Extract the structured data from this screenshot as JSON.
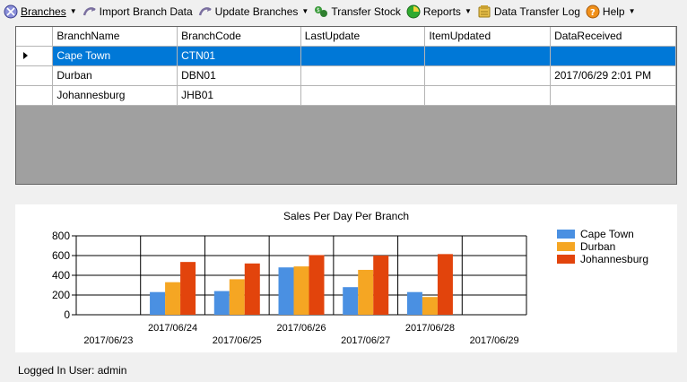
{
  "toolbar": {
    "items": [
      {
        "label": "Branches",
        "icon": "branches-icon",
        "dropdown": true
      },
      {
        "label": "Import Branch Data",
        "icon": "import-icon",
        "dropdown": false
      },
      {
        "label": "Update Branches",
        "icon": "update-icon",
        "dropdown": true
      },
      {
        "label": "Transfer Stock",
        "icon": "transfer-icon",
        "dropdown": false
      },
      {
        "label": "Reports",
        "icon": "reports-icon",
        "dropdown": true
      },
      {
        "label": "Data Transfer Log",
        "icon": "log-icon",
        "dropdown": false
      },
      {
        "label": "Help",
        "icon": "help-icon",
        "dropdown": true
      }
    ]
  },
  "grid": {
    "columns": [
      "BranchName",
      "BranchCode",
      "LastUpdate",
      "ItemUpdated",
      "DataReceived"
    ],
    "rows": [
      [
        "Cape Town",
        "CTN01",
        "",
        "",
        ""
      ],
      [
        "Durban",
        "DBN01",
        "",
        "",
        "2017/06/29 2:01 PM"
      ],
      [
        "Johannesburg",
        "JHB01",
        "",
        "",
        ""
      ]
    ],
    "selected_row": 0
  },
  "chart_data": {
    "type": "bar",
    "title": "Sales Per Day Per Branch",
    "categories": [
      "2017/06/23",
      "2017/06/24",
      "2017/06/25",
      "2017/06/26",
      "2017/06/27",
      "2017/06/28",
      "2017/06/29"
    ],
    "series": [
      {
        "name": "Cape Town",
        "color": "#4a90e2",
        "values": [
          0,
          230,
          240,
          480,
          280,
          230,
          0
        ]
      },
      {
        "name": "Durban",
        "color": "#f5a623",
        "values": [
          0,
          330,
          360,
          490,
          455,
          180,
          0
        ]
      },
      {
        "name": "Johannesburg",
        "color": "#e2440c",
        "values": [
          0,
          535,
          520,
          605,
          600,
          615,
          0
        ]
      }
    ],
    "ylim": [
      0,
      800
    ],
    "yticks": [
      0,
      200,
      400,
      600,
      800
    ],
    "grid": true,
    "legend": "right"
  },
  "status": {
    "label": "Logged In User: admin"
  }
}
